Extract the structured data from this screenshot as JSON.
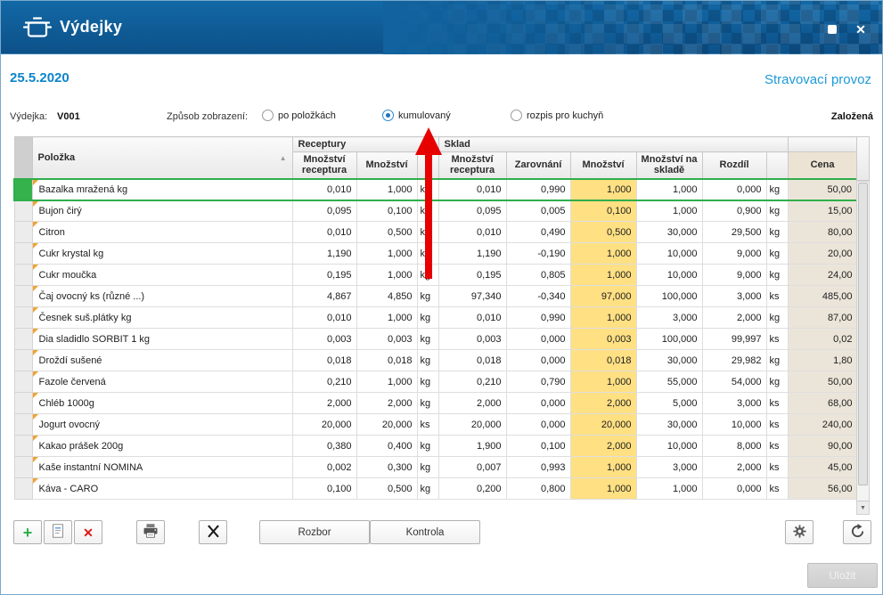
{
  "window": {
    "title": "Výdejky"
  },
  "infobar": {
    "date": "25.5.2020",
    "operation": "Stravovací provoz"
  },
  "filterbar": {
    "vydejka_label": "Výdejka:",
    "vydejka_value": "V001",
    "mode_label": "Způsob zobrazení:",
    "options": [
      {
        "label": "po položkách",
        "selected": false
      },
      {
        "label": "kumulovaný",
        "selected": true
      },
      {
        "label": "rozpis pro kuchyň",
        "selected": false
      }
    ],
    "status": "Založená"
  },
  "table": {
    "group_receptury": "Receptury",
    "group_sklad": "Sklad",
    "col_polozka": "Položka",
    "col_rec_mnozstvi_receptura": "Množství receptura",
    "col_rec_mnozstvi": "Množství",
    "col_sk_mnozstvi_receptura": "Množství receptura",
    "col_zarovnani": "Zarovnání",
    "col_sk_mnozstvi": "Množství",
    "col_mnozstvi_na_sklade": "Množství na skladě",
    "col_rozdil": "Rozdíl",
    "col_cena": "Cena",
    "rows": [
      {
        "name": "Bazalka mražená kg",
        "rec_rcp": "0,010",
        "rec_mn": "1,000",
        "unit1": "kg",
        "sk_rcp": "0,010",
        "zarov": "0,990",
        "sk_mn": "1,000",
        "sklad": "1,000",
        "rozdil": "0,000",
        "unit2": "kg",
        "cena": "50,00",
        "selected": true
      },
      {
        "name": "Bujon čirý",
        "rec_rcp": "0,095",
        "rec_mn": "0,100",
        "unit1": "kg",
        "sk_rcp": "0,095",
        "zarov": "0,005",
        "sk_mn": "0,100",
        "sklad": "1,000",
        "rozdil": "0,900",
        "unit2": "kg",
        "cena": "15,00",
        "selected": false
      },
      {
        "name": "Citron",
        "rec_rcp": "0,010",
        "rec_mn": "0,500",
        "unit1": "kg",
        "sk_rcp": "0,010",
        "zarov": "0,490",
        "sk_mn": "0,500",
        "sklad": "30,000",
        "rozdil": "29,500",
        "unit2": "kg",
        "cena": "80,00",
        "selected": false
      },
      {
        "name": "Cukr krystal kg",
        "rec_rcp": "1,190",
        "rec_mn": "1,000",
        "unit1": "kg",
        "sk_rcp": "1,190",
        "zarov": "-0,190",
        "sk_mn": "1,000",
        "sklad": "10,000",
        "rozdil": "9,000",
        "unit2": "kg",
        "cena": "20,00",
        "selected": false
      },
      {
        "name": "Cukr moučka",
        "rec_rcp": "0,195",
        "rec_mn": "1,000",
        "unit1": "kg",
        "sk_rcp": "0,195",
        "zarov": "0,805",
        "sk_mn": "1,000",
        "sklad": "10,000",
        "rozdil": "9,000",
        "unit2": "kg",
        "cena": "24,00",
        "selected": false
      },
      {
        "name": "Čaj ovocný  ks (různé ...)",
        "rec_rcp": "4,867",
        "rec_mn": "4,850",
        "unit1": "kg",
        "sk_rcp": "97,340",
        "zarov": "-0,340",
        "sk_mn": "97,000",
        "sklad": "100,000",
        "rozdil": "3,000",
        "unit2": "ks",
        "cena": "485,00",
        "selected": false
      },
      {
        "name": "Česnek suš.plátky  kg",
        "rec_rcp": "0,010",
        "rec_mn": "1,000",
        "unit1": "kg",
        "sk_rcp": "0,010",
        "zarov": "0,990",
        "sk_mn": "1,000",
        "sklad": "3,000",
        "rozdil": "2,000",
        "unit2": "kg",
        "cena": "87,00",
        "selected": false
      },
      {
        "name": "Dia sladidlo SORBIT 1 kg",
        "rec_rcp": "0,003",
        "rec_mn": "0,003",
        "unit1": "kg",
        "sk_rcp": "0,003",
        "zarov": "0,000",
        "sk_mn": "0,003",
        "sklad": "100,000",
        "rozdil": "99,997",
        "unit2": "ks",
        "cena": "0,02",
        "selected": false
      },
      {
        "name": "Droždí sušené",
        "rec_rcp": "0,018",
        "rec_mn": "0,018",
        "unit1": "kg",
        "sk_rcp": "0,018",
        "zarov": "0,000",
        "sk_mn": "0,018",
        "sklad": "30,000",
        "rozdil": "29,982",
        "unit2": "kg",
        "cena": "1,80",
        "selected": false
      },
      {
        "name": "Fazole červená",
        "rec_rcp": "0,210",
        "rec_mn": "1,000",
        "unit1": "kg",
        "sk_rcp": "0,210",
        "zarov": "0,790",
        "sk_mn": "1,000",
        "sklad": "55,000",
        "rozdil": "54,000",
        "unit2": "kg",
        "cena": "50,00",
        "selected": false
      },
      {
        "name": "Chléb 1000g",
        "rec_rcp": "2,000",
        "rec_mn": "2,000",
        "unit1": "kg",
        "sk_rcp": "2,000",
        "zarov": "0,000",
        "sk_mn": "2,000",
        "sklad": "5,000",
        "rozdil": "3,000",
        "unit2": "ks",
        "cena": "68,00",
        "selected": false
      },
      {
        "name": "Jogurt  ovocný",
        "rec_rcp": "20,000",
        "rec_mn": "20,000",
        "unit1": "ks",
        "sk_rcp": "20,000",
        "zarov": "0,000",
        "sk_mn": "20,000",
        "sklad": "30,000",
        "rozdil": "10,000",
        "unit2": "ks",
        "cena": "240,00",
        "selected": false
      },
      {
        "name": "Kakao prášek 200g",
        "rec_rcp": "0,380",
        "rec_mn": "0,400",
        "unit1": "kg",
        "sk_rcp": "1,900",
        "zarov": "0,100",
        "sk_mn": "2,000",
        "sklad": "10,000",
        "rozdil": "8,000",
        "unit2": "ks",
        "cena": "90,00",
        "selected": false
      },
      {
        "name": "Kaše instantní NOMINA",
        "rec_rcp": "0,002",
        "rec_mn": "0,300",
        "unit1": "kg",
        "sk_rcp": "0,007",
        "zarov": "0,993",
        "sk_mn": "1,000",
        "sklad": "3,000",
        "rozdil": "2,000",
        "unit2": "ks",
        "cena": "45,00",
        "selected": false
      },
      {
        "name": "Káva - CARO",
        "rec_rcp": "0,100",
        "rec_mn": "0,500",
        "unit1": "kg",
        "sk_rcp": "0,200",
        "zarov": "0,800",
        "sk_mn": "1,000",
        "sklad": "1,000",
        "rozdil": "0,000",
        "unit2": "ks",
        "cena": "56,00",
        "selected": false
      }
    ]
  },
  "toolbar": {
    "rozbor": "Rozbor",
    "kontrola": "Kontrola"
  },
  "footer": {
    "save": "Uložit"
  },
  "icons": {
    "add": "+",
    "delete": "✕",
    "close": "✕",
    "sort_asc": "▲",
    "scroll_down": "▼"
  },
  "annotation": {
    "type": "arrow",
    "color": "#e60000",
    "points_to_option": "kumulovaný"
  },
  "colors": {
    "titlebar_blue": "#0f5c96",
    "date_blue": "#0d84c9",
    "link_blue": "#1d9ad8",
    "highlight_yellow": "#ffe083",
    "price_beige": "#ebe5d9",
    "selected_green": "#2fae4b",
    "arrow_red": "#e60000"
  }
}
